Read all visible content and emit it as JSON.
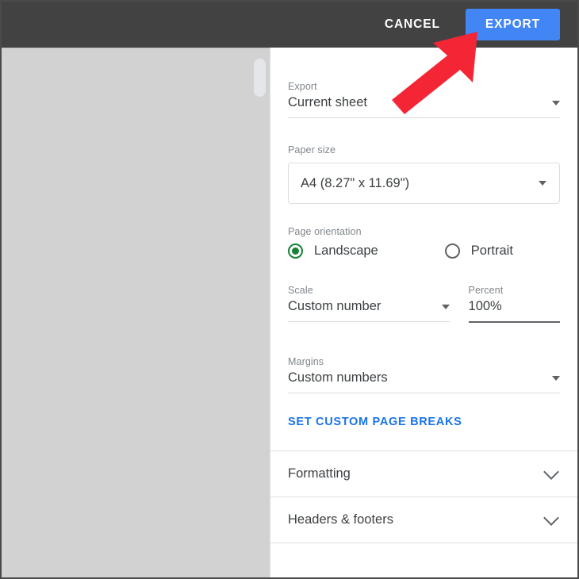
{
  "toolbar": {
    "cancel_label": "CANCEL",
    "export_label": "EXPORT",
    "background_color": "#424242",
    "export_button_color": "#4285F4"
  },
  "preview": {
    "background_color": "#D2D2D2",
    "scrollbar_name": "vertical-scrollbar"
  },
  "settings": {
    "export": {
      "label": "Export",
      "value": "Current sheet"
    },
    "paper_size": {
      "label": "Paper size",
      "value": "A4 (8.27\" x 11.69\")"
    },
    "page_orientation": {
      "label": "Page orientation",
      "selected": "Landscape",
      "options": [
        {
          "label": "Landscape",
          "selected": true
        },
        {
          "label": "Portrait",
          "selected": false
        }
      ],
      "selected_color": "#188038"
    },
    "scale": {
      "label": "Scale",
      "value": "Custom number"
    },
    "percent": {
      "label": "Percent",
      "value": "100%"
    },
    "margins": {
      "label": "Margins",
      "value": "Custom numbers"
    },
    "page_breaks_link": "SET CUSTOM PAGE BREAKS",
    "link_color": "#1A73E8",
    "sections": [
      {
        "label": "Formatting"
      },
      {
        "label": "Headers & footers"
      }
    ]
  },
  "annotation": {
    "arrow_color": "#F42534",
    "points_to": "EXPORT"
  }
}
